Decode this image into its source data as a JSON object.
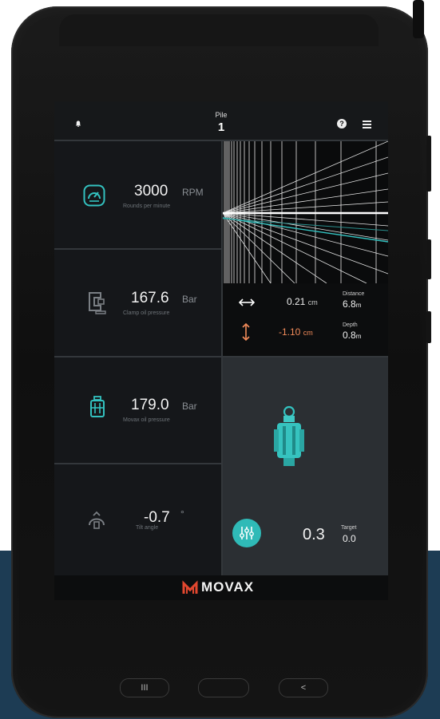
{
  "topbar": {
    "pile_label": "Pile",
    "pile_value": "1",
    "help_icon": "question-circle-icon",
    "menu_icon": "hamburger-icon",
    "bell_icon": "bell-icon"
  },
  "metrics": [
    {
      "value": "3000",
      "unit": "RPM",
      "label": "Rounds per minute",
      "icon": "gauge-icon"
    },
    {
      "value": "167.6",
      "unit": "Bar",
      "label": "Clamp oil pressure",
      "icon": "clamp-icon"
    },
    {
      "value": "179.0",
      "unit": "Bar",
      "label": "Movax oil pressure",
      "icon": "hammer-icon"
    },
    {
      "value": "-0.7",
      "unit": "°",
      "label": "Tilt angle",
      "icon": "tilt-icon"
    }
  ],
  "alignment": {
    "horizontal": {
      "value": "0.21",
      "unit": "cm",
      "side_label": "Distance",
      "side_value": "6.8",
      "side_unit": "m"
    },
    "vertical": {
      "value": "-1.10",
      "unit": "cm",
      "side_label": "Depth",
      "side_value": "0.8",
      "side_unit": "m"
    }
  },
  "target": {
    "current": "0.3",
    "label": "Target",
    "value": "0.0",
    "button_icon": "sliders-icon"
  },
  "brand": {
    "name": "MOVAX"
  },
  "hardware_buttons": [
    "III",
    "",
    "<"
  ],
  "colors": {
    "accent": "#33c2c0",
    "warning": "#f28b5a",
    "background": "#15171a"
  }
}
